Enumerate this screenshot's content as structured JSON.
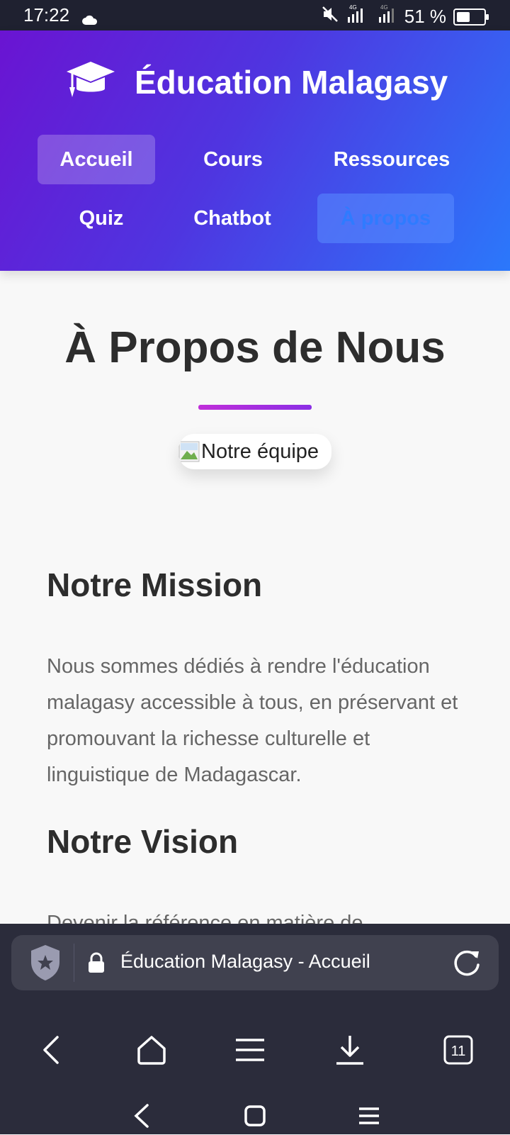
{
  "status_bar": {
    "time": "17:22",
    "network_label": "4G",
    "battery_percent": "51 %",
    "battery_level": 0.51
  },
  "header": {
    "brand_name": "Éducation Malagasy",
    "brand_icon": "graduation-cap-icon",
    "nav": {
      "home": "Accueil",
      "courses": "Cours",
      "resources": "Ressources",
      "quiz": "Quiz",
      "chatbot": "Chatbot",
      "about": "À propos"
    }
  },
  "main": {
    "title": "À Propos de Nous",
    "team_image_alt": "Notre équipe",
    "mission_heading": "Notre Mission",
    "mission_text": "Nous sommes dédiés à rendre l'éducation malagasy accessible à tous, en préservant et promouvant la richesse culturelle et linguistique de Madagascar.",
    "vision_heading": "Notre Vision",
    "vision_text_partial": "Devenir la référence en matière de"
  },
  "browser": {
    "url_text": "Éducation Malagasy - Accueil",
    "tab_count": "11"
  },
  "colors": {
    "header_gradient_start": "#6a14d2",
    "header_gradient_end": "#2b78fb",
    "accent": "#c02ed9",
    "browser_bg": "#2b2c3b"
  }
}
